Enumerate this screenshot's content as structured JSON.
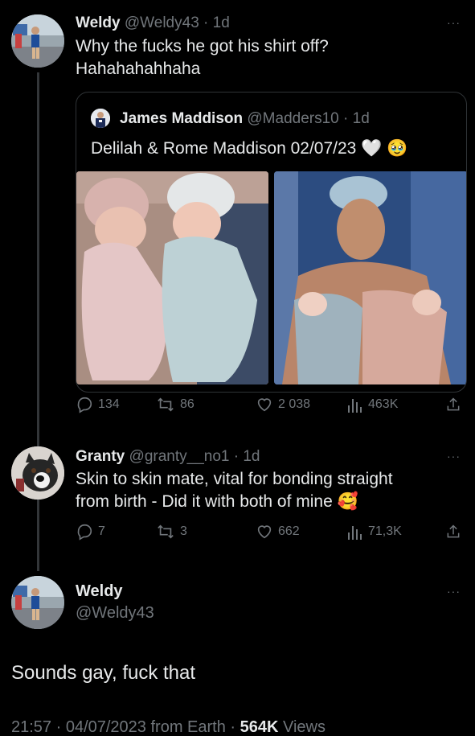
{
  "tweet1": {
    "name": "Weldy",
    "handle": "@Weldy43",
    "time": "· 1d",
    "line1": "Why the fucks he got his shirt off?",
    "line2": "Hahahahahhaha",
    "more": "···",
    "quote": {
      "name": "James Maddison",
      "handle": "@Madders10",
      "time": "· 1d",
      "text": "Delilah & Rome Maddison 02/07/23",
      "emoji": "🤍 🥹"
    },
    "stats": {
      "replies": "134",
      "retweets": "86",
      "likes": "2 038",
      "views": "463K"
    }
  },
  "tweet2": {
    "name": "Granty",
    "handle": "@granty__no1",
    "time": "· 1d",
    "line1": "Skin to skin mate, vital for bonding straight",
    "line2": "from birth - Did it with both of mine",
    "emoji": "🥰",
    "more": "···",
    "stats": {
      "replies": "7",
      "retweets": "3",
      "likes": "662",
      "views": "71,3K"
    }
  },
  "main": {
    "name": "Weldy",
    "handle": "@Weldy43",
    "more": "···",
    "text": "Sounds gay, fuck that",
    "meta": "21:57 · 04/07/2023 from Earth ·",
    "views_count": "564K",
    "views_label": "Views"
  },
  "icons": [
    "reply-icon",
    "retweet-icon",
    "like-icon",
    "views-icon",
    "share-icon"
  ],
  "colors": {
    "background": "#000000",
    "text": "#e7e9ea",
    "muted": "#71767b",
    "border": "#2f3336"
  }
}
